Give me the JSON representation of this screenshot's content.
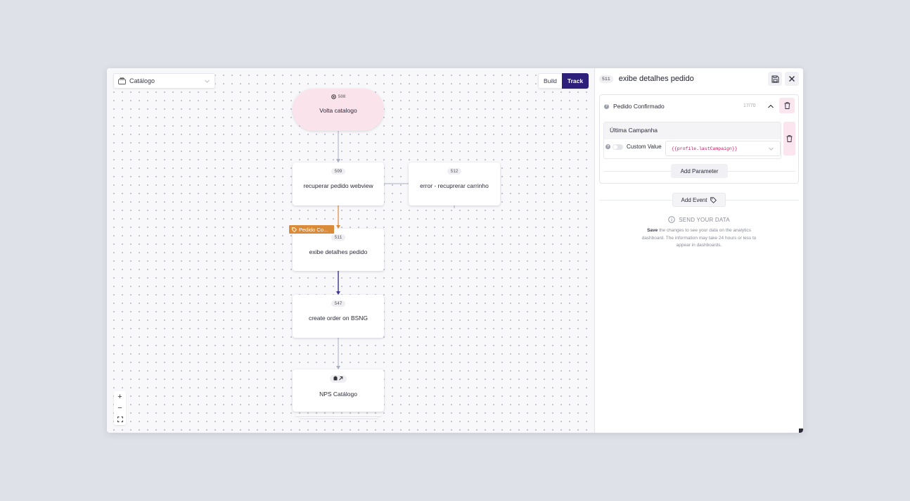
{
  "toolbar": {
    "catalog_select": "Catálogo",
    "mode_build": "Build",
    "mode_track": "Track"
  },
  "flow": {
    "start_node": {
      "id": "508",
      "label": "Volta catalogo"
    },
    "nodes": [
      {
        "id": "509",
        "label": "recuperar pedido webview"
      },
      {
        "id": "512",
        "label": "error - recuprerar carrinho"
      },
      {
        "id": "511",
        "label": "exibe detalhes pedido"
      },
      {
        "id": "547",
        "label": "create order on BSNG"
      }
    ],
    "nps_node": {
      "label": "NPS Catálogo"
    },
    "event_tag": "Pedido Co..."
  },
  "zoom": {
    "in": "+",
    "out": "−",
    "fit": "⛶"
  },
  "panel": {
    "node_id": "511",
    "title": "exibe detalhes pedido",
    "event": {
      "name": "Pedido Confirmado",
      "counter": "17/70",
      "parameter": {
        "name": "Última Campanha",
        "custom_label": "Custom Value",
        "value": "{{profile.lastCampaign}}"
      },
      "add_parameter": "Add Parameter"
    },
    "add_event": "Add Event",
    "send_title": "SEND YOUR DATA",
    "send_bold": "Save",
    "send_text": " the changes to see your data on the analytics dashboard. The information may take 24 hours or less to appear in dashboards."
  },
  "colors": {
    "accent": "#2e1f7a",
    "start_node": "#fbe3ec",
    "event_tag": "#d98b3a",
    "edge_highlight": "#3b3590"
  }
}
